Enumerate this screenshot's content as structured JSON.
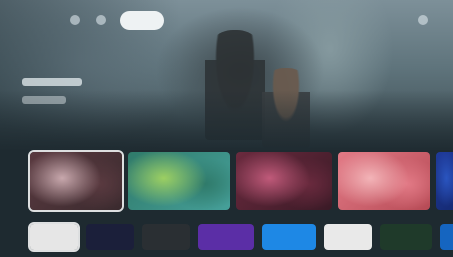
{
  "hero": {
    "chip_icon": "featured-chip",
    "palette": {
      "sky": "#7d9099",
      "base": "#1e2a30"
    }
  },
  "cards": [
    {
      "name": "card-1",
      "colors": [
        "#5a3a40",
        "#c8a8ad",
        "#3a2a2e"
      ]
    },
    {
      "name": "card-2",
      "colors": [
        "#2f7a6a",
        "#9ccf62",
        "#46a09a"
      ]
    },
    {
      "name": "card-3",
      "colors": [
        "#6a2a3e",
        "#c05a7a",
        "#3a1a26"
      ]
    },
    {
      "name": "card-4",
      "colors": [
        "#e27a86",
        "#f3b4b8",
        "#b64a55"
      ]
    },
    {
      "name": "card-5",
      "colors": [
        "#1f3a9a",
        "#2a55c0",
        "#14286e"
      ]
    }
  ],
  "apps": [
    {
      "name": "app-1",
      "color": "#e6e6e6"
    },
    {
      "name": "app-2",
      "color": "#1b1f3a"
    },
    {
      "name": "app-3",
      "color": "#2a2f33"
    },
    {
      "name": "app-4",
      "color": "#5b2ea6"
    },
    {
      "name": "app-5",
      "color": "#1e88e5"
    },
    {
      "name": "app-6",
      "color": "#e9e9e9"
    },
    {
      "name": "app-7",
      "color": "#1f3a2a"
    },
    {
      "name": "app-8",
      "color": "#1565c0"
    }
  ]
}
